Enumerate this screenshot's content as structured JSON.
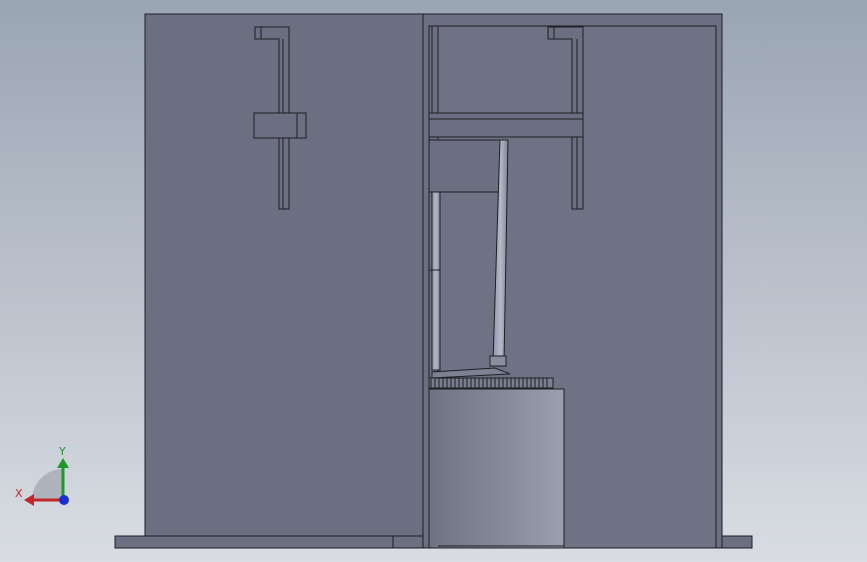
{
  "viewport": {
    "background_top": "#9aa5b3",
    "background_bottom": "#d9dde3"
  },
  "model": {
    "body_color": "#6b6f81",
    "body_color_light": "#7a7f90",
    "edge_color": "#1e1f24",
    "cylinder_highlight": "#9aa0b0"
  },
  "triad": {
    "x_label": "X",
    "y_label": "Y",
    "x_color": "#c0282a",
    "y_color": "#1f9a2a",
    "z_color": "#1a2fd0",
    "x_icon": "axis-x-arrow",
    "y_icon": "axis-y-arrow",
    "z_icon": "axis-z-dot"
  }
}
